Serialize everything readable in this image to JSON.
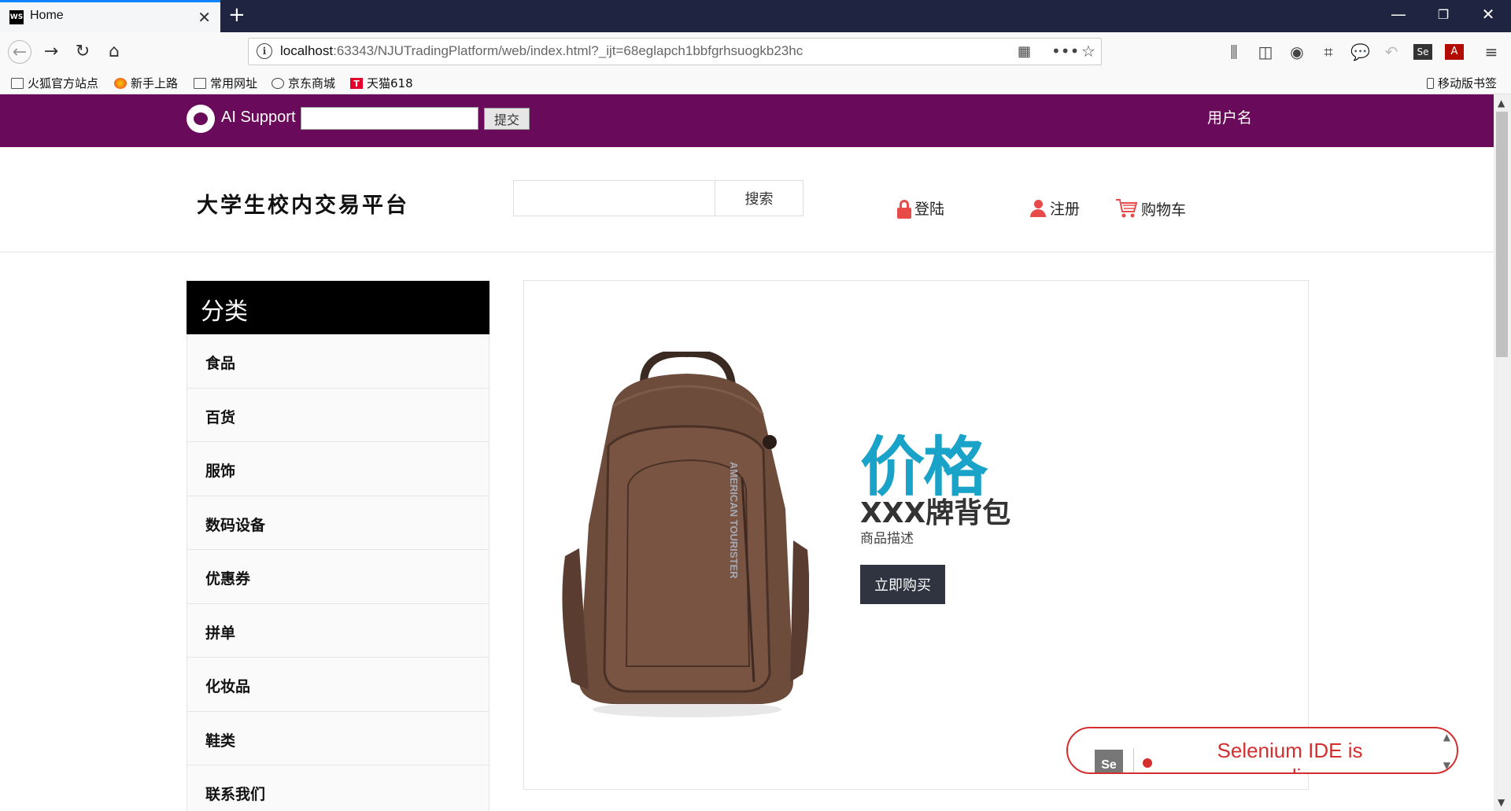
{
  "browser": {
    "tab_title": "Home",
    "tab_favicon": "WS",
    "url_host": "localhost",
    "url_rest": ":63343/NJUTradingPlatform/web/index.html?_ijt=68eglapch1bbfgrhsuogkb23hc",
    "bookmarks": [
      "火狐官方站点",
      "新手上路",
      "常用网址",
      "京东商城",
      "天猫618"
    ],
    "mobile_bookmarks": "移动版书签"
  },
  "support": {
    "label": "AI Support",
    "submit_label": "提交",
    "input_value": "",
    "username": "用户名"
  },
  "header": {
    "brand": "大学生校内交易平台",
    "search_button": "搜索",
    "search_value": "",
    "login": "登陆",
    "register": "注册",
    "cart": "购物车"
  },
  "category": {
    "title": "分类",
    "items": [
      "食品",
      "百货",
      "服饰",
      "数码设备",
      "优惠券",
      "拼单",
      "化妆品",
      "鞋类",
      "联系我们"
    ]
  },
  "banner": {
    "price_label": "价格",
    "product_name": "XXX牌背包",
    "description": "商品描述",
    "buy_button": "立即购买",
    "bag_text": "AMERICAN TOURISTER"
  },
  "selenium": {
    "logo": "Se",
    "message": "Selenium IDE is recording..."
  },
  "colors": {
    "support_bar": "#6a0a5b",
    "price": "#1aa3c9",
    "accent_red": "#e84a4a",
    "buy_button": "#2f3440"
  }
}
